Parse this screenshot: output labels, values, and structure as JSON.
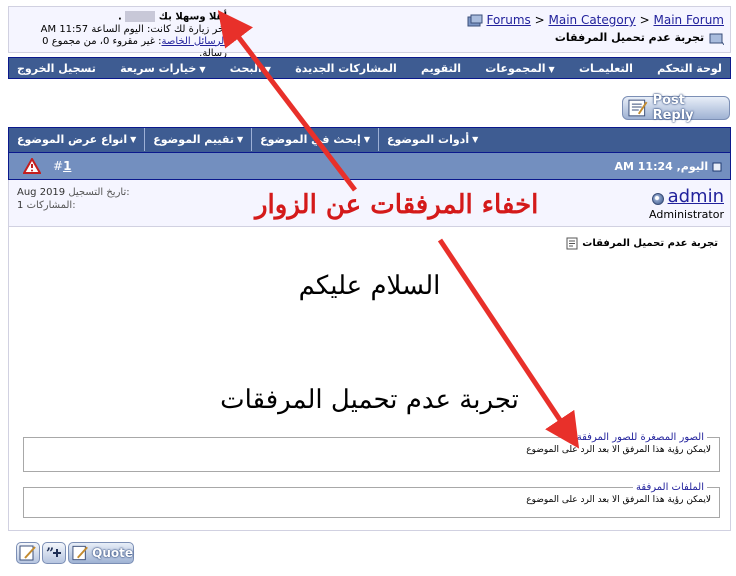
{
  "header": {
    "breadcrumb": [
      "Forums",
      "Main Category",
      "Main Forum"
    ],
    "breadcrumb_sep": ">",
    "thread_title": "تجربة عدم تحميل المرفقات",
    "welcome": "أهلا وسهلا بك",
    "last_visit": "آخر زيارة لك كانت: اليوم الساعة 11:57 AM",
    "pm_label": "الرسائل الخاصة",
    "pm_status": ": غير مقروء 0، من مجموع 0 رسالة."
  },
  "navbar": {
    "items": [
      {
        "label": "لوحة التحكم",
        "dropdown": false
      },
      {
        "label": "التعليمـات",
        "dropdown": false
      },
      {
        "label": "المجموعات",
        "dropdown": true
      },
      {
        "label": "التقويم",
        "dropdown": false
      },
      {
        "label": "المشاركات الجديدة",
        "dropdown": false
      },
      {
        "label": "البحث",
        "dropdown": true
      },
      {
        "label": "خيارات سريعة",
        "dropdown": true
      },
      {
        "label": "تسجيل الخروج",
        "dropdown": false
      }
    ]
  },
  "post_reply_label": "Post Reply",
  "thread_tools": {
    "items": [
      {
        "label": "أدوات الموضوع"
      },
      {
        "label": "إبحث في الموضوع"
      },
      {
        "label": "تقييم الموضوع"
      },
      {
        "label": "انواع عرض الموضوع"
      }
    ]
  },
  "post": {
    "date": "اليوم, 11:24 AM",
    "number_prefix": "#",
    "number": "1",
    "username": "admin",
    "user_title": "Administrator",
    "join_label": "تاريخ التسجيل:",
    "join_value": "Aug 2019",
    "posts_label": "المشاركات:",
    "posts_value": "1",
    "title": "تجربة عدم تحميل المرفقات",
    "greeting": "السلام عليكم",
    "content": "تجربة عدم تحميل المرفقات",
    "thumb_legend": "الصور المصغرة للصور المرفقة",
    "thumb_notice": "لايمكن رؤية هذا المرفق الا بعد الرد على الموضوع",
    "files_legend": "الملفات المرفقة",
    "files_notice": "لايمكن رؤية هذا المرفق الا بعد الرد على الموضوع"
  },
  "quote_label": "Quote",
  "annotation": {
    "text": "اخفاء المرفقات عن الزوار",
    "color": "#D41A1A"
  },
  "colors": {
    "navbar": "#3E5C92",
    "post_header": "#738FBF",
    "link": "#22229C",
    "panel": "#F5F5FF"
  }
}
